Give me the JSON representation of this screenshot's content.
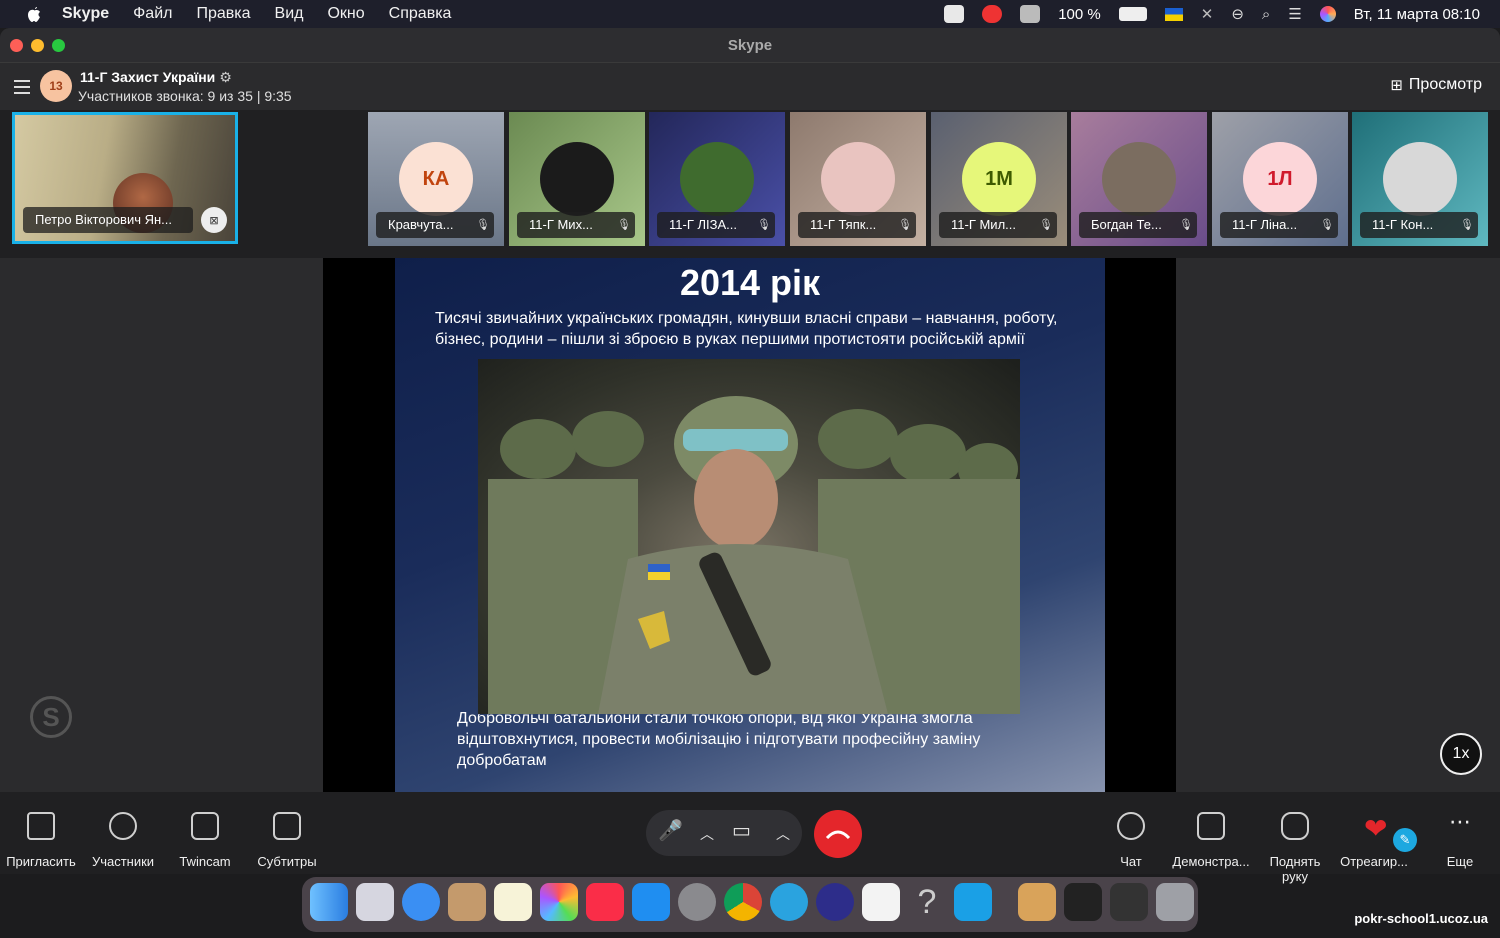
{
  "menubar": {
    "app": "Skype",
    "items": [
      "Файл",
      "Правка",
      "Вид",
      "Окно",
      "Справка"
    ],
    "battery": "100 %",
    "datetime": "Вт, 11 марта  08:10"
  },
  "window": {
    "title": "Skype"
  },
  "header": {
    "group_badge": "13",
    "group_name": "11-Г Захист України",
    "subtitle": "Участников звонка: 9 из 35 | 9:35",
    "view_label": "Просмотр"
  },
  "self_tile": {
    "name": "Петро Вікторович Ян..."
  },
  "participants": [
    {
      "name": "Кравчута...",
      "initials": "КА",
      "bg": "#fbe1d4",
      "fg": "#c1440e"
    },
    {
      "name": "11-Г Мих...",
      "initials": "",
      "bg": "#1b1b1b",
      "fg": "#fff"
    },
    {
      "name": "11-Г ЛІЗА...",
      "initials": "",
      "bg": "#3f6b2e",
      "fg": "#fff"
    },
    {
      "name": "11-Г Тяпк...",
      "initials": "",
      "bg": "#e9c4c0",
      "fg": "#fff"
    },
    {
      "name": "11-Г Мил...",
      "initials": "1М",
      "bg": "#e6f77a",
      "fg": "#3d5a00"
    },
    {
      "name": "Богдан Те...",
      "initials": "",
      "bg": "#7b6d60",
      "fg": "#fff"
    },
    {
      "name": "11-Г Ліна...",
      "initials": "1Л",
      "bg": "#fcd6d9",
      "fg": "#d01a2c"
    },
    {
      "name": "11-Г Кон...",
      "initials": "",
      "bg": "#d8d8d8",
      "fg": "#fff"
    }
  ],
  "slide": {
    "title": "2014 рік",
    "para1": "Тисячі звичайних українських громадян, кинувши власні справи – навчання, роботу, бізнес, родини – пішли зі зброєю в руках першими протистояти російській армії",
    "para2": "Добровольчі батальйони стали точкою опори, від якої Україна змогла відштовхнутися, провести мобілізацію і підготувати професійну заміну добробатам"
  },
  "speed": "1x",
  "toolbar": {
    "invite": "Пригласить",
    "participants": "Участники",
    "twincam": "Twincam",
    "subtitles": "Субтитры",
    "chat": "Чат",
    "share": "Демонстра...",
    "raise_hand": "Поднять руку",
    "react": "Отреагир...",
    "more": "Еще"
  },
  "watermark": "pokr-school1.ucoz.ua"
}
